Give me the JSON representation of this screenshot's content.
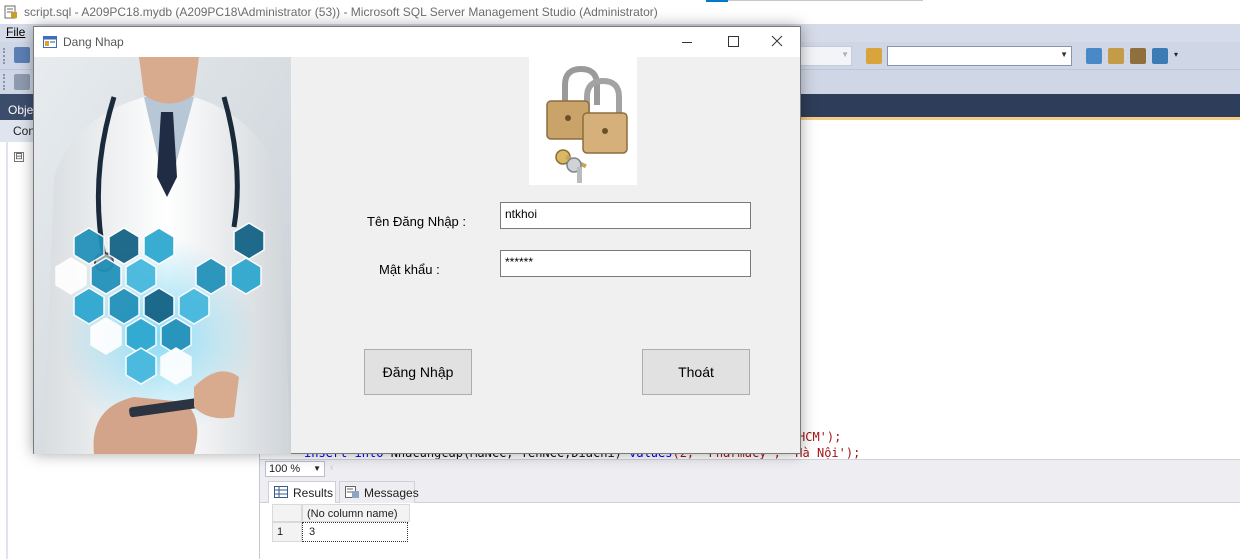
{
  "ssms": {
    "window_title": "script.sql - A209PC18.mydb (A209PC18\\Administrator (53)) - Microsoft SQL Server Management Studio (Administrator)",
    "menu_file": "File",
    "object_explorer_title": "Obje",
    "object_explorer_connect": "Con",
    "tree_toggle": "⊟",
    "code_lines": [
      {
        "kw": "",
        "text": "",
        "str": "HCM');"
      },
      {
        "kw": "insert into",
        "text": " Nhacungcap(MaNCC, TenNCC,Diachi) ",
        "kw2": "values",
        "str": "(2, 'Pharmacy', 'Hà Nội');"
      }
    ],
    "zoom_level": "100 %",
    "results_tab": "Results",
    "messages_tab": "Messages",
    "grid": {
      "column_header": "(No column name)",
      "row_number": "1",
      "cell_value": "3"
    }
  },
  "dialog": {
    "title": "Dang Nhap",
    "username_label": "Tên Đăng Nhập :",
    "password_label": "Mật khẩu :",
    "username_value": "ntkhoi",
    "password_value": "******",
    "login_button": "Đăng Nhập",
    "exit_button": "Thoát"
  },
  "colors": {
    "ssms_dark_header": "#2e3d59",
    "ssms_tab_accent": "#f5cc84",
    "dialog_bg": "#f0f0f0",
    "button_bg": "#e1e1e1",
    "hex_icons": "#1f8fb8"
  },
  "icons": {
    "app": "ssms-script-icon",
    "dialog": "form-window-icon",
    "minimize": "minimize-icon",
    "maximize": "maximize-icon",
    "close": "close-icon",
    "lock": "padlocks-with-keys-image"
  }
}
